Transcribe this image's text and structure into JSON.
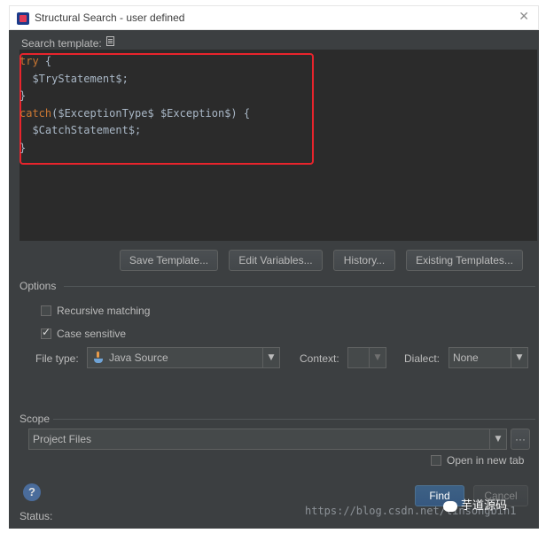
{
  "window": {
    "title": "Structural Search - user defined",
    "close_glyph": "✕"
  },
  "search_template": {
    "label": "Search template:",
    "code_lines": [
      [
        {
          "t": "try",
          "k": "kw"
        },
        {
          "t": " {",
          "k": "tpl"
        }
      ],
      [
        {
          "t": "  $TryStatement$;",
          "k": "tpl"
        }
      ],
      [
        {
          "t": "}",
          "k": "tpl"
        }
      ],
      [
        {
          "t": "catch",
          "k": "kw"
        },
        {
          "t": "($ExceptionType$ $Exception$) {",
          "k": "tpl"
        }
      ],
      [
        {
          "t": "  $CatchStatement$;",
          "k": "tpl"
        }
      ],
      [
        {
          "t": "}",
          "k": "tpl"
        }
      ]
    ]
  },
  "buttons": {
    "save_template": "Save Template...",
    "edit_variables": "Edit Variables...",
    "history": "History...",
    "existing_templates": "Existing Templates...",
    "find": "Find",
    "cancel": "Cancel",
    "more": "···"
  },
  "options": {
    "title": "Options",
    "recursive_matching": {
      "label": "Recursive matching",
      "checked": false
    },
    "case_sensitive": {
      "label": "Case sensitive",
      "checked": true
    },
    "file_type": {
      "label": "File type:",
      "value": "Java Source"
    },
    "context": {
      "label": "Context:",
      "value": ""
    },
    "dialect": {
      "label": "Dialect:",
      "value": "None"
    }
  },
  "scope": {
    "title": "Scope",
    "value": "Project Files",
    "open_new_tab": {
      "label": "Open in new tab",
      "checked": false
    }
  },
  "status": {
    "label": "Status:"
  },
  "help": {
    "glyph": "?"
  },
  "watermark": {
    "url": "https://blog.csdn.net/linsongbin1",
    "wechat": "芋道源码"
  },
  "colors": {
    "background": "#3c3f41",
    "editor": "#2b2b2b",
    "keyword": "#cc7832",
    "highlight": "#e8242c"
  }
}
